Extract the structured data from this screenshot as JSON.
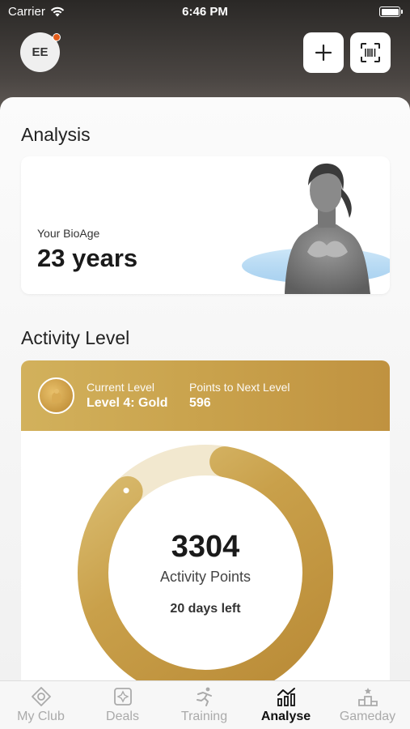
{
  "status_bar": {
    "carrier": "Carrier",
    "time": "6:46 PM"
  },
  "header": {
    "avatar_initials": "EE"
  },
  "analysis": {
    "title": "Analysis",
    "bio_label": "Your BioAge",
    "bio_value": "23 years"
  },
  "activity": {
    "title": "Activity Level",
    "current_level_label": "Current Level",
    "current_level_value": "Level 4: Gold",
    "next_level_label": "Points to Next Level",
    "next_level_value": "596",
    "points_value": "3304",
    "points_label": "Activity Points",
    "days_left": "20 days left",
    "progress_fraction": 0.85,
    "colors": {
      "gold": "#c9a04a",
      "track": "#f2e8cf"
    }
  },
  "tabs": [
    {
      "label": "My Club",
      "icon": "target-icon"
    },
    {
      "label": "Deals",
      "icon": "deals-icon"
    },
    {
      "label": "Training",
      "icon": "runner-icon"
    },
    {
      "label": "Analyse",
      "icon": "chart-icon",
      "active": true
    },
    {
      "label": "Gameday",
      "icon": "podium-icon"
    }
  ]
}
